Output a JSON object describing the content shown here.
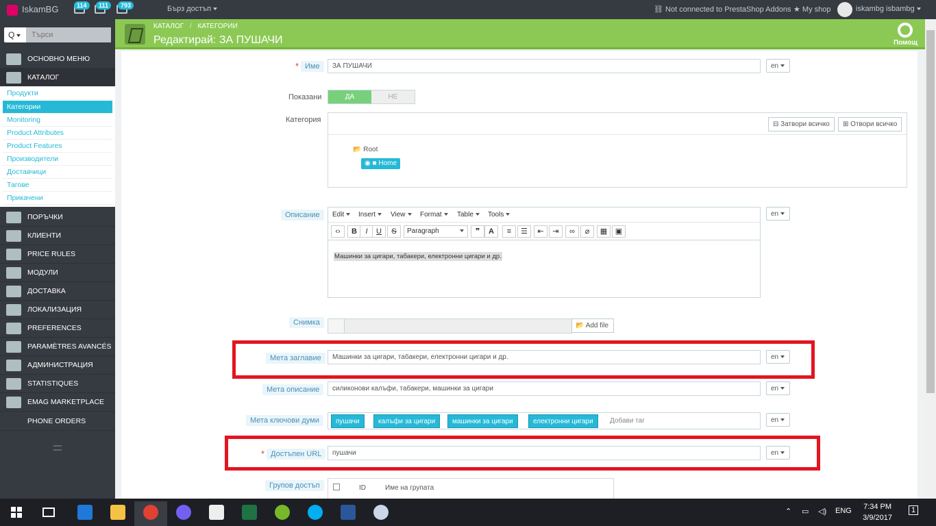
{
  "topbar": {
    "brand": "IskamBG",
    "badges": [
      "114",
      "111",
      "793"
    ],
    "quick_access": "Бърз достъп",
    "addons": "Not connected to PrestaShop Addons",
    "my_shop": "My shop",
    "user": "iskambg isbambg"
  },
  "sidebar": {
    "search_btn": "Q",
    "search_placeholder": "Търси",
    "menu": [
      {
        "label": "Основно меню",
        "icon": "dashboard-icon"
      },
      {
        "label": "Каталог",
        "icon": "book-icon"
      },
      {
        "label": "Поръчки",
        "icon": "cart-icon"
      },
      {
        "label": "Клиенти",
        "icon": "users-icon"
      },
      {
        "label": "Price rules",
        "icon": "tag-icon"
      },
      {
        "label": "Модули",
        "icon": "puzzle-icon"
      },
      {
        "label": "Доставка",
        "icon": "truck-icon"
      },
      {
        "label": "Локализация",
        "icon": "globe-icon"
      },
      {
        "label": "Preferences",
        "icon": "wrench-icon"
      },
      {
        "label": "Paramètres avancés",
        "icon": "cogs-icon"
      },
      {
        "label": "Администрация",
        "icon": "gear-icon"
      },
      {
        "label": "Statistiques",
        "icon": "stats-icon"
      },
      {
        "label": "Emag marketplace",
        "icon": "card-icon"
      },
      {
        "label": "Phone orders",
        "icon": "phone-icon"
      }
    ],
    "submenu": [
      "Продукти",
      "Категории",
      "Monitoring",
      "Product Attributes",
      "Product Features",
      "Производители",
      "Доставчици",
      "Тагове",
      "Прикачени"
    ]
  },
  "header": {
    "crumb1": "КАТАЛОГ",
    "crumb2": "КАТЕГОРИИ",
    "title": "Редактирай: ЗА ПУШАЧИ",
    "help": "Помощ"
  },
  "form": {
    "name_label": "Име",
    "name_value": "ЗА ПУШАЧИ",
    "lang": "en",
    "shown_label": "Показани",
    "yes": "ДА",
    "no": "НЕ",
    "category_label": "Категория",
    "collapse_all": "Затвори всичко",
    "expand_all": "Отвори всичко",
    "root": "Root",
    "home": "Home",
    "description_label": "Описание",
    "editor_menu": [
      "Edit",
      "Insert",
      "View",
      "Format",
      "Table",
      "Tools"
    ],
    "paragraph": "Paragraph",
    "description_text": "Машинки за цигари, табакери, електронни цигари и др.",
    "image_label": "Снимка",
    "add_file": "Add file",
    "meta_title_label": "Мета заглавие",
    "meta_title_value": "Машинки за цигари, табакери, електронни цигари и др.",
    "meta_desc_label": "Мета описание",
    "meta_desc_value": "силиконови калъфи, табакери, машинки за цигари",
    "meta_keywords_label": "Мета ключови думи",
    "tags": [
      "пушачи",
      "калъфи за цигари",
      "машинки за цигари",
      "електронни цигари"
    ],
    "add_tag": "Добави таг",
    "url_label": "Достъпен URL",
    "url_value": "пушачи",
    "group_label": "Групов достъп",
    "group_id": "ID",
    "group_name": "Име на групата"
  },
  "taskbar": {
    "lang": "ENG",
    "time": "7:34 PM",
    "date": "3/9/2017",
    "notif": "1"
  }
}
